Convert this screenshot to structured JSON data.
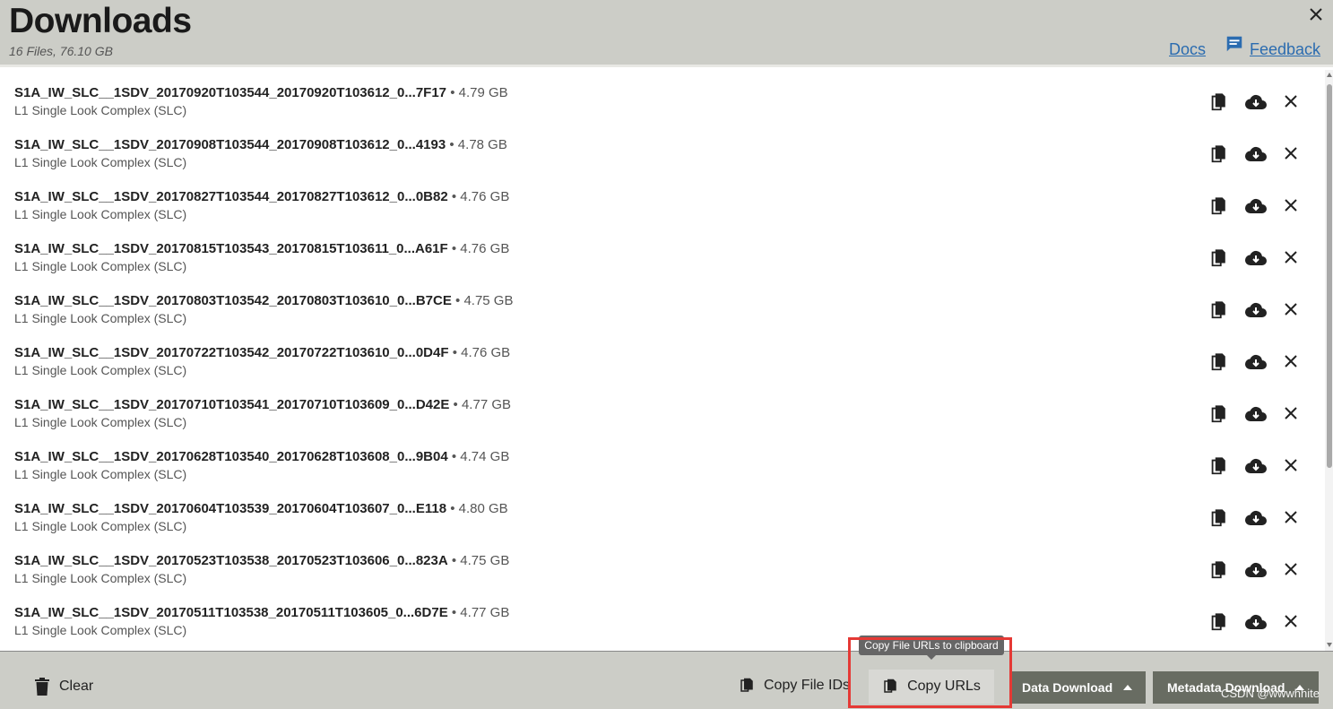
{
  "header": {
    "title": "Downloads",
    "subtitle": "16 Files, 76.10 GB",
    "docs_label": "Docs",
    "feedback_label": "Feedback"
  },
  "files": [
    {
      "name": "S1A_IW_SLC__1SDV_20170920T103544_20170920T103612_0...7F17",
      "size": " • 4.79 GB",
      "type": "L1 Single Look Complex (SLC)"
    },
    {
      "name": "S1A_IW_SLC__1SDV_20170908T103544_20170908T103612_0...4193",
      "size": " • 4.78 GB",
      "type": "L1 Single Look Complex (SLC)"
    },
    {
      "name": "S1A_IW_SLC__1SDV_20170827T103544_20170827T103612_0...0B82",
      "size": " • 4.76 GB",
      "type": "L1 Single Look Complex (SLC)"
    },
    {
      "name": "S1A_IW_SLC__1SDV_20170815T103543_20170815T103611_0...A61F",
      "size": " • 4.76 GB",
      "type": "L1 Single Look Complex (SLC)"
    },
    {
      "name": "S1A_IW_SLC__1SDV_20170803T103542_20170803T103610_0...B7CE",
      "size": " • 4.75 GB",
      "type": "L1 Single Look Complex (SLC)"
    },
    {
      "name": "S1A_IW_SLC__1SDV_20170722T103542_20170722T103610_0...0D4F",
      "size": " • 4.76 GB",
      "type": "L1 Single Look Complex (SLC)"
    },
    {
      "name": "S1A_IW_SLC__1SDV_20170710T103541_20170710T103609_0...D42E",
      "size": " • 4.77 GB",
      "type": "L1 Single Look Complex (SLC)"
    },
    {
      "name": "S1A_IW_SLC__1SDV_20170628T103540_20170628T103608_0...9B04",
      "size": " • 4.74 GB",
      "type": "L1 Single Look Complex (SLC)"
    },
    {
      "name": "S1A_IW_SLC__1SDV_20170604T103539_20170604T103607_0...E118",
      "size": " • 4.80 GB",
      "type": "L1 Single Look Complex (SLC)"
    },
    {
      "name": "S1A_IW_SLC__1SDV_20170523T103538_20170523T103606_0...823A",
      "size": " • 4.75 GB",
      "type": "L1 Single Look Complex (SLC)"
    },
    {
      "name": "S1A_IW_SLC__1SDV_20170511T103538_20170511T103605_0...6D7E",
      "size": " • 4.77 GB",
      "type": "L1 Single Look Complex (SLC)"
    }
  ],
  "footer": {
    "clear_label": "Clear",
    "copy_ids_label": "Copy File IDs",
    "copy_urls_label": "Copy URLs",
    "data_download_label": "Data Download",
    "metadata_download_label": "Metadata Download"
  },
  "tooltip": "Copy File URLs to clipboard",
  "watermark": "CSDN @wwwhhite",
  "colors": {
    "panel_bg": "#cccdc7",
    "link": "#2b6cb0",
    "dark_button": "#686c62",
    "highlight": "#e53935"
  },
  "icons": {
    "row_actions": [
      "copy-icon",
      "cloud-download-icon",
      "close-icon"
    ],
    "footer": [
      "trash-icon",
      "copy-icon",
      "caret-up-icon"
    ]
  }
}
